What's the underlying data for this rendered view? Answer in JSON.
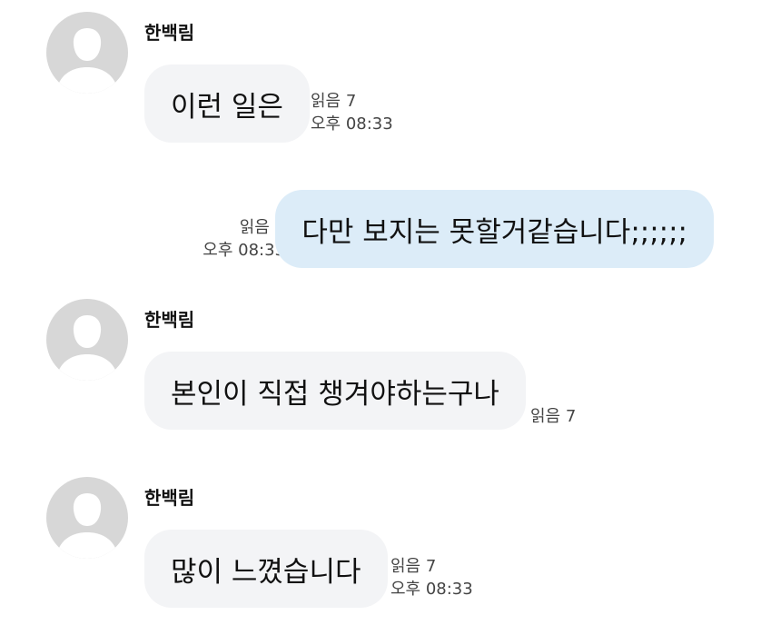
{
  "messages": [
    {
      "direction": "incoming",
      "sender": "한백림",
      "text": "이런 일은",
      "read_label": "읽음 7",
      "time": "오후 08:33"
    },
    {
      "direction": "outgoing",
      "text": "다만 보지는 못할거같습니다;;;;;;",
      "read_label": "읽음 7",
      "time": "오후 08:33"
    },
    {
      "direction": "incoming",
      "sender": "한백림",
      "text": "본인이 직접 챙겨야하는구나",
      "read_label": "읽음 7"
    },
    {
      "direction": "incoming",
      "sender": "한백림",
      "text": "많이 느꼈습니다",
      "read_label": "읽음 7",
      "time": "오후 08:33"
    }
  ],
  "icons": {
    "avatar": "default-profile-icon"
  },
  "colors": {
    "incoming_bubble": "#f3f4f6",
    "outgoing_bubble": "#dcecf8",
    "avatar_bg": "#d7d7d7",
    "avatar_figure": "#ffffff"
  }
}
